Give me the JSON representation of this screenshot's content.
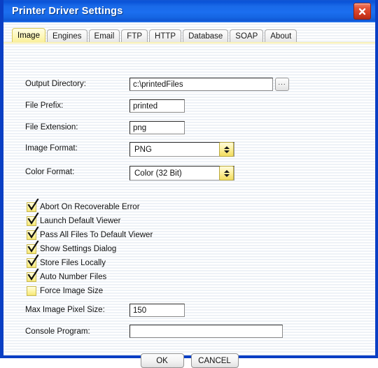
{
  "window": {
    "title": "Printer Driver Settings",
    "close_label": "×",
    "accent_color": "#0a3fc4",
    "titlebar_color": "#1b6ef0",
    "close_color": "#d03a20",
    "tab_active_color": "#faf09a",
    "checkbox_color": "#f6e775"
  },
  "tabs": [
    {
      "label": "Image",
      "active": true
    },
    {
      "label": "Engines",
      "active": false
    },
    {
      "label": "Email",
      "active": false
    },
    {
      "label": "FTP",
      "active": false
    },
    {
      "label": "HTTP",
      "active": false
    },
    {
      "label": "Database",
      "active": false
    },
    {
      "label": "SOAP",
      "active": false
    },
    {
      "label": "About",
      "active": false
    }
  ],
  "fields": {
    "output_directory": {
      "label": "Output Directory:",
      "value": "c:\\printedFiles",
      "placeholder": "",
      "browse_label": "..."
    },
    "file_prefix": {
      "label": "File Prefix:",
      "value": "printed",
      "placeholder": ""
    },
    "file_extension": {
      "label": "File Extension:",
      "value": "png",
      "placeholder": ""
    },
    "image_format": {
      "label": "Image Format:",
      "value": "PNG"
    },
    "color_format": {
      "label": "Color Format:",
      "value": "Color (32 Bit)"
    },
    "max_image_pixel_size": {
      "label": "Max Image Pixel Size:",
      "value": "150",
      "placeholder": ""
    },
    "console_program": {
      "label": "Console Program:",
      "value": "",
      "placeholder": ""
    }
  },
  "checkboxes": [
    {
      "label": "Abort On Recoverable Error",
      "checked": true
    },
    {
      "label": "Launch Default Viewer",
      "checked": true
    },
    {
      "label": "Pass All Files To Default Viewer",
      "checked": true
    },
    {
      "label": "Show Settings Dialog",
      "checked": true
    },
    {
      "label": "Store Files Locally",
      "checked": true
    },
    {
      "label": "Auto Number Files",
      "checked": true
    },
    {
      "label": "Force Image Size",
      "checked": false
    }
  ],
  "buttons": {
    "ok": "OK",
    "cancel": "CANCEL"
  }
}
